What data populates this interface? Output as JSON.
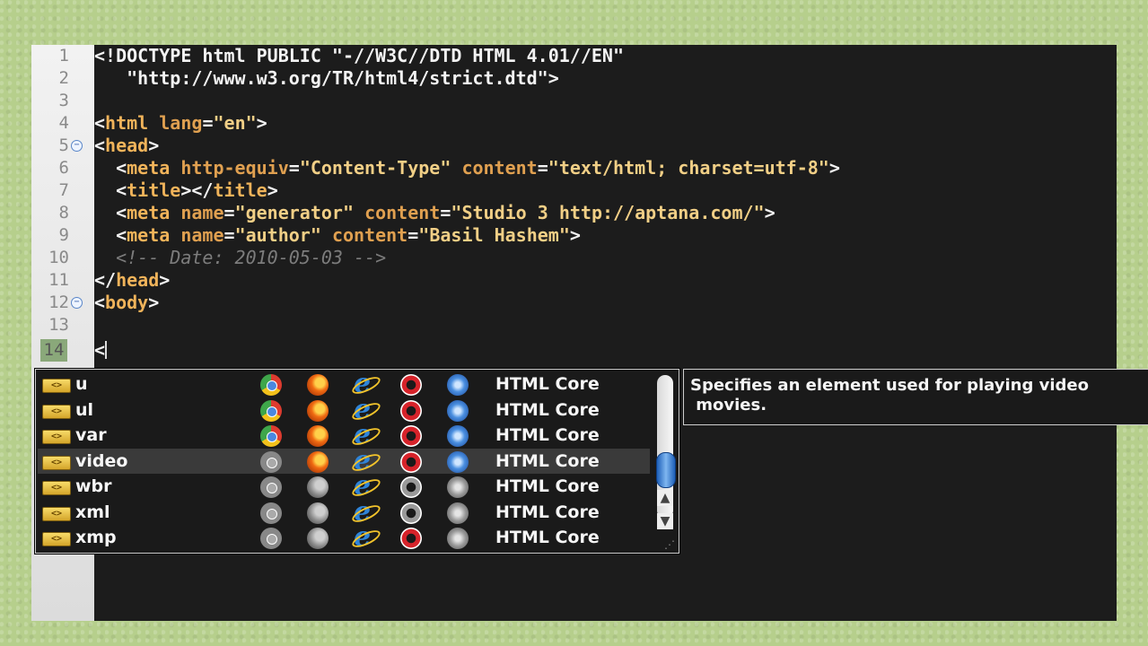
{
  "lines": [
    {
      "num": "1"
    },
    {
      "num": "2"
    },
    {
      "num": "3"
    },
    {
      "num": "4"
    },
    {
      "num": "5"
    },
    {
      "num": "6"
    },
    {
      "num": "7"
    },
    {
      "num": "8"
    },
    {
      "num": "9"
    },
    {
      "num": "10"
    },
    {
      "num": "11"
    },
    {
      "num": "12"
    },
    {
      "num": "13"
    },
    {
      "num": "14"
    }
  ],
  "code": {
    "l1": "<!DOCTYPE html PUBLIC \"-//W3C//DTD HTML 4.01//EN\"",
    "l2": "   \"http://www.w3.org/TR/html4/strict.dtd\">",
    "l4_open": "<",
    "l4_tag": "html",
    "l4_sp": " ",
    "l4_attr": "lang",
    "l4_eq": "=",
    "l4_val": "\"en\"",
    "l4_close": ">",
    "l5_open": "<",
    "l5_tag": "head",
    "l5_close": ">",
    "l6_pre": "  <",
    "l6_tag": "meta",
    "l6_a1": "http-equiv",
    "l6_v1": "\"Content-Type\"",
    "l6_a2": "content",
    "l6_v2": "\"text/html; charset=utf-8\"",
    "l6_close": ">",
    "l7_pre": "  <",
    "l7_tag": "title",
    "l7_mid": "></",
    "l7_tag2": "title",
    "l7_close": ">",
    "l8_pre": "  <",
    "l8_tag": "meta",
    "l8_a1": "name",
    "l8_v1": "\"generator\"",
    "l8_a2": "content",
    "l8_v2": "\"Studio 3 http://aptana.com/\"",
    "l8_close": ">",
    "l9_pre": "  <",
    "l9_tag": "meta",
    "l9_a1": "name",
    "l9_v1": "\"author\"",
    "l9_a2": "content",
    "l9_v2": "\"Basil Hashem\"",
    "l9_close": ">",
    "l10": "  <!-- Date: 2010-05-03 -->",
    "l11_open": "</",
    "l11_tag": "head",
    "l11_close": ">",
    "l12_open": "<",
    "l12_tag": "body",
    "l12_close": ">",
    "l14": "<"
  },
  "fold_icon": "minus-circle-icon",
  "autocomplete": {
    "tag_icon_text": "<>",
    "items": [
      {
        "name": "u",
        "chrome": true,
        "firefox": true,
        "ie": true,
        "opera": true,
        "safari": true,
        "lib": "HTML Core"
      },
      {
        "name": "ul",
        "chrome": true,
        "firefox": true,
        "ie": true,
        "opera": true,
        "safari": true,
        "lib": "HTML Core"
      },
      {
        "name": "var",
        "chrome": true,
        "firefox": true,
        "ie": true,
        "opera": true,
        "safari": true,
        "lib": "HTML Core"
      },
      {
        "name": "video",
        "chrome": false,
        "firefox": true,
        "ie": true,
        "opera": true,
        "safari": true,
        "lib": "HTML Core"
      },
      {
        "name": "wbr",
        "chrome": false,
        "firefox": false,
        "ie": true,
        "opera": false,
        "safari": false,
        "lib": "HTML Core"
      },
      {
        "name": "xml",
        "chrome": false,
        "firefox": false,
        "ie": true,
        "opera": false,
        "safari": false,
        "lib": "HTML Core"
      },
      {
        "name": "xmp",
        "chrome": false,
        "firefox": false,
        "ie": true,
        "opera": true,
        "safari": false,
        "lib": "HTML Core"
      }
    ],
    "selected_index": 3,
    "scroll_up": "▲",
    "scroll_down": "▼",
    "grip": "⋰"
  },
  "doc_popup": {
    "text": "Specifies an element used for playing video\n movies."
  },
  "ie_glyph": "e",
  "colors": {
    "tag": "#f0b35a",
    "string": "#f1cf86",
    "comment": "#7c7c7c",
    "background": "#1c1c1c"
  }
}
